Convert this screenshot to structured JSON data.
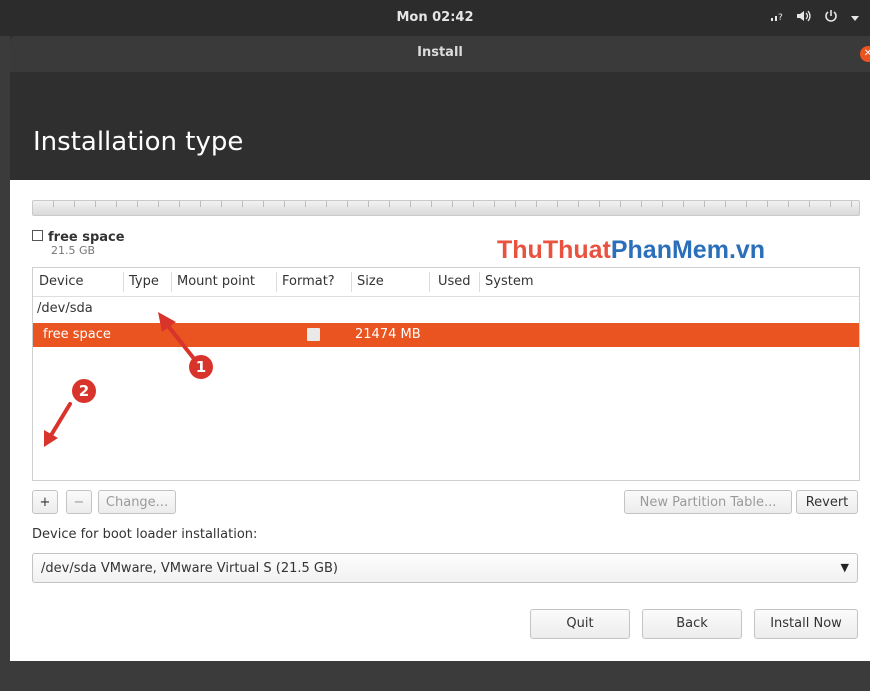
{
  "topbar": {
    "clock": "Mon 02:42",
    "tray_icons": [
      "network-icon",
      "volume-icon",
      "power-icon",
      "menu-arrow-icon"
    ]
  },
  "window": {
    "title": "Install",
    "heading": "Installation type"
  },
  "partition_bar": {
    "legend_name": "free space",
    "legend_size": "21.5 GB"
  },
  "watermark": {
    "part1": "ThuThuat",
    "part2": "PhanMem",
    "part3": ".vn"
  },
  "table": {
    "columns": [
      "Device",
      "Type",
      "Mount point",
      "Format?",
      "Size",
      "Used",
      "System"
    ],
    "device_row": "/dev/sda",
    "selected_row": {
      "device": "free space",
      "type": "",
      "mount": "",
      "format_checked": false,
      "size": "21474 MB",
      "used": "",
      "system": ""
    }
  },
  "controls": {
    "add": "+",
    "remove": "−",
    "change": "Change...",
    "new_table": "New Partition Table...",
    "revert": "Revert"
  },
  "bootloader": {
    "label": "Device for boot loader installation:",
    "selected": "/dev/sda VMware, VMware Virtual S (21.5 GB)"
  },
  "actions": {
    "quit": "Quit",
    "back": "Back",
    "install": "Install Now"
  },
  "annotations": [
    "1",
    "2"
  ],
  "colors": {
    "accent": "#e95420",
    "header_bg": "#2f2f2f",
    "watermark_red": "#e8523f",
    "watermark_blue": "#2b6fba",
    "annotation_red": "#d9342b"
  }
}
